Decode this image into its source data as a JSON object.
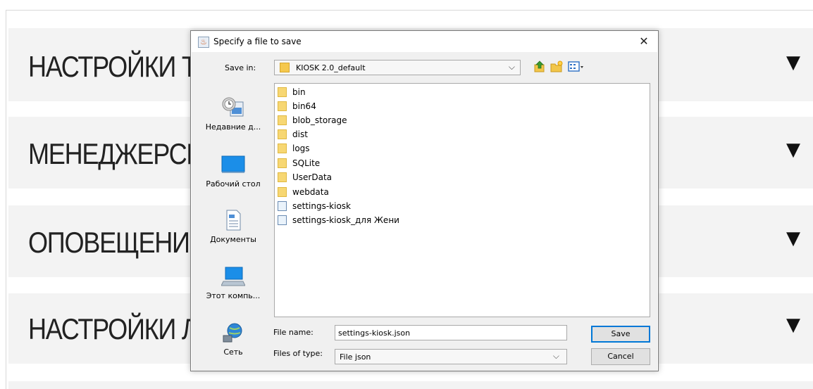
{
  "background": {
    "sections": [
      {
        "title": "НАСТРОЙКИ Т",
        "arrow": "▼"
      },
      {
        "title": "МЕНЕДЖЕРСК",
        "arrow": "▼"
      },
      {
        "title": "ОПОВЕЩЕНИЯ",
        "arrow": "▼"
      },
      {
        "title": "НАСТРОЙКИ Л",
        "arrow": "▼"
      }
    ]
  },
  "dialog": {
    "title": "Specify a file to save",
    "close_label": "✕",
    "save_in": {
      "label": "Save in:",
      "value": "KIOSK 2.0_default",
      "chevron": "⌵"
    },
    "toolbar": {
      "up_icon": "up-folder-icon",
      "new_folder_icon": "new-folder-icon",
      "view_menu_icon": "view-menu-icon"
    },
    "places": [
      {
        "label": "Недавние д...",
        "icon": "recent-icon"
      },
      {
        "label": "Рабочий стол",
        "icon": "desktop-icon"
      },
      {
        "label": "Документы",
        "icon": "documents-icon"
      },
      {
        "label": "Этот компь...",
        "icon": "computer-icon"
      },
      {
        "label": "Сеть",
        "icon": "network-icon"
      }
    ],
    "files": [
      {
        "name": "bin",
        "type": "folder"
      },
      {
        "name": "bin64",
        "type": "folder"
      },
      {
        "name": "blob_storage",
        "type": "folder"
      },
      {
        "name": "dist",
        "type": "folder"
      },
      {
        "name": "logs",
        "type": "folder"
      },
      {
        "name": "SQLite",
        "type": "folder"
      },
      {
        "name": "UserData",
        "type": "folder"
      },
      {
        "name": "webdata",
        "type": "folder"
      },
      {
        "name": "settings-kiosk",
        "type": "file"
      },
      {
        "name": "settings-kiosk_для Жени",
        "type": "file"
      }
    ],
    "file_name": {
      "label": "File name:",
      "value": "settings-kiosk.json"
    },
    "file_type": {
      "label": "Files of type:",
      "value": "File json",
      "chevron": "⌵"
    },
    "buttons": {
      "save": "Save",
      "cancel": "Cancel"
    }
  }
}
